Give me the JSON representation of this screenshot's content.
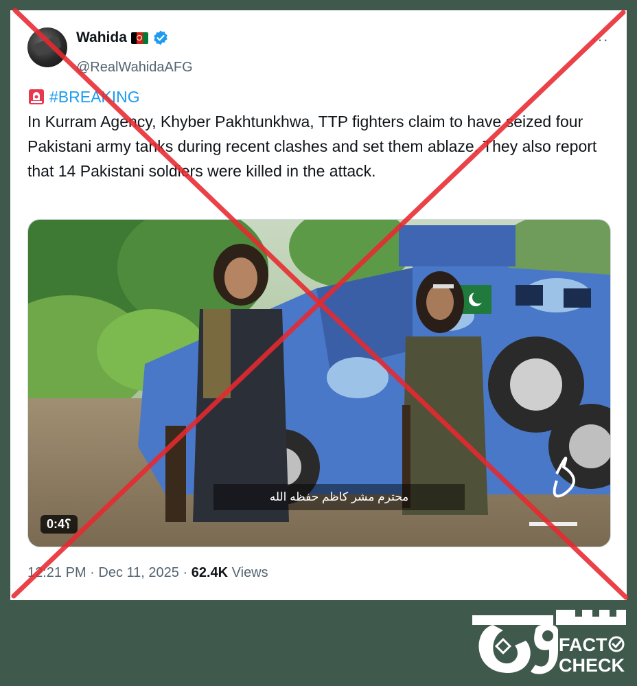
{
  "tweet": {
    "author_name": "Wahida",
    "author_handle": "@RealWahidaAFG",
    "more_label": "···",
    "hashtag": "#BREAKING",
    "body": "In Kurram Agency, Khyber Pakhtunkhwa, TTP fighters claim to have seized four Pakistani army tanks during recent clashes and set them ablaze. They also report that 14 Pakistani soldiers were killed in the attack.",
    "video": {
      "duration": "0:4؟",
      "subtitle": "محترم مشر کاظم حفظه الله"
    },
    "time": "12:21 PM",
    "separator": "·",
    "date": "Dec 11, 2025",
    "views_count": "62.4K",
    "views_label": "Views"
  },
  "overlay": {
    "cross_color": "#e8292f"
  },
  "logo": {
    "line1": "FACT",
    "line2": "CHECK"
  },
  "colors": {
    "background": "#3f5a4c",
    "link": "#1d9bf0",
    "verified": "#1d9bf0"
  },
  "icons": [
    "afghan-flag-icon",
    "verified-badge-icon",
    "siren-icon",
    "more-icon",
    "checkmark-circle-icon"
  ]
}
